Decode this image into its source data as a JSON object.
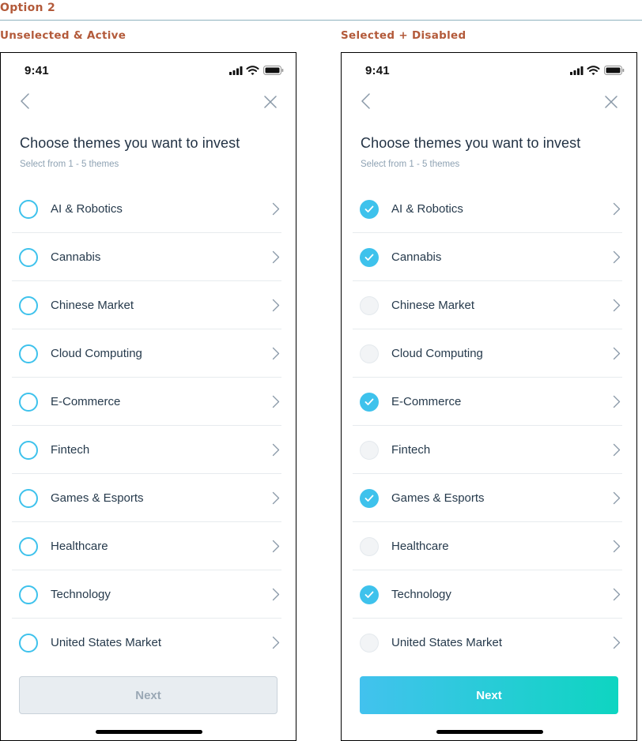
{
  "page": {
    "option_title": "Option 2",
    "left_label": "Unselected & Active",
    "right_label": "Selected + Disabled"
  },
  "colors": {
    "accent": "#3ec2ec",
    "annotation": "#b35a3a",
    "gradient_start": "#42c2ee",
    "gradient_end": "#0ed5c1"
  },
  "screens": [
    {
      "status_time": "9:41",
      "title": "Choose themes you want to invest",
      "subtitle": "Select from 1 - 5 themes",
      "next_label": "Next",
      "next_state": "disabled",
      "themes": [
        {
          "label": "AI & Robotics",
          "state": "active"
        },
        {
          "label": "Cannabis",
          "state": "active"
        },
        {
          "label": "Chinese Market",
          "state": "active"
        },
        {
          "label": "Cloud Computing",
          "state": "active"
        },
        {
          "label": "E-Commerce",
          "state": "active"
        },
        {
          "label": "Fintech",
          "state": "active"
        },
        {
          "label": "Games & Esports",
          "state": "active"
        },
        {
          "label": "Healthcare",
          "state": "active"
        },
        {
          "label": "Technology",
          "state": "active"
        },
        {
          "label": "United States Market",
          "state": "active"
        }
      ]
    },
    {
      "status_time": "9:41",
      "title": "Choose themes you want to invest",
      "subtitle": "Select from 1 - 5 themes",
      "next_label": "Next",
      "next_state": "enabled",
      "themes": [
        {
          "label": "AI & Robotics",
          "state": "checked"
        },
        {
          "label": "Cannabis",
          "state": "checked"
        },
        {
          "label": "Chinese Market",
          "state": "disabled"
        },
        {
          "label": "Cloud Computing",
          "state": "disabled"
        },
        {
          "label": "E-Commerce",
          "state": "checked"
        },
        {
          "label": "Fintech",
          "state": "disabled"
        },
        {
          "label": "Games & Esports",
          "state": "checked"
        },
        {
          "label": "Healthcare",
          "state": "disabled"
        },
        {
          "label": "Technology",
          "state": "checked"
        },
        {
          "label": "United States Market",
          "state": "disabled"
        }
      ]
    }
  ]
}
